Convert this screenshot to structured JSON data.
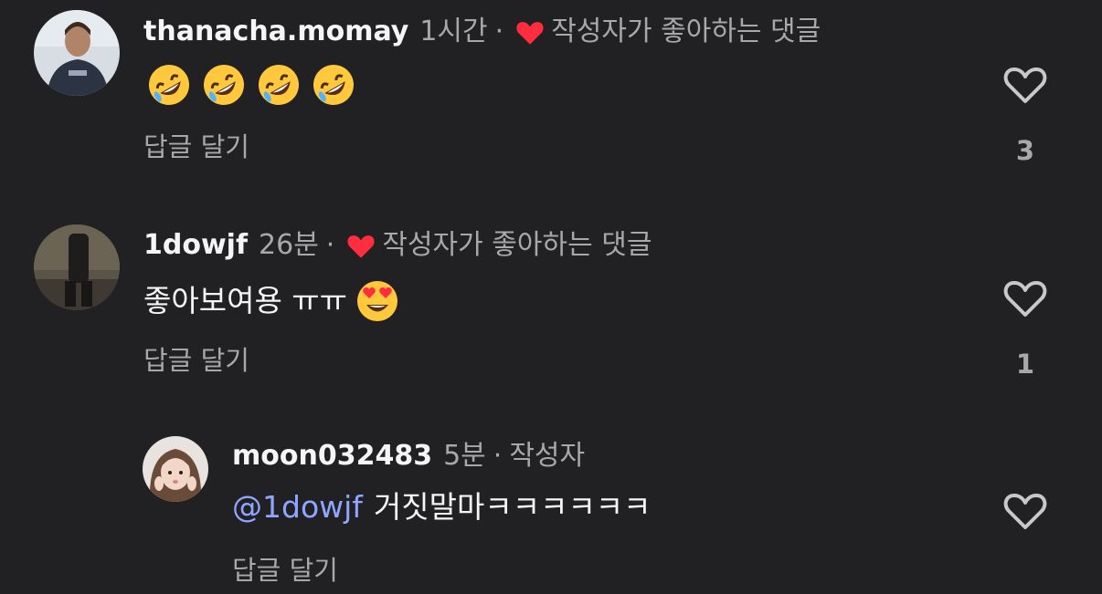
{
  "comments": [
    {
      "username": "thanacha.momay",
      "time": "1시간",
      "separator": "·",
      "creator_liked_label": "작성자가 좋아하는 댓글",
      "body_emojis": [
        "rolling-laughing",
        "rolling-laughing",
        "rolling-laughing",
        "rolling-laughing"
      ],
      "reply_label": "답글 달기",
      "like_count": "3"
    },
    {
      "username": "1dowjf",
      "time": "26분",
      "separator": "·",
      "creator_liked_label": "작성자가 좋아하는 댓글",
      "body_text": "좋아보여용 ㅠㅠ",
      "body_emoji": "heart-eyes",
      "reply_label": "답글 달기",
      "like_count": "1"
    },
    {
      "username": "moon032483",
      "time": "5분",
      "separator": "·",
      "author_label": "작성자",
      "mention": "@1dowjf",
      "body_text": "거짓말마ㅋㅋㅋㅋㅋㅋ",
      "reply_label": "답글 달기"
    }
  ],
  "colors": {
    "background": "#212123",
    "text": "#f5f5f5",
    "dim": "#a8a8a8",
    "heart_red": "#ff2d3d",
    "mention": "#8fa5ff"
  }
}
